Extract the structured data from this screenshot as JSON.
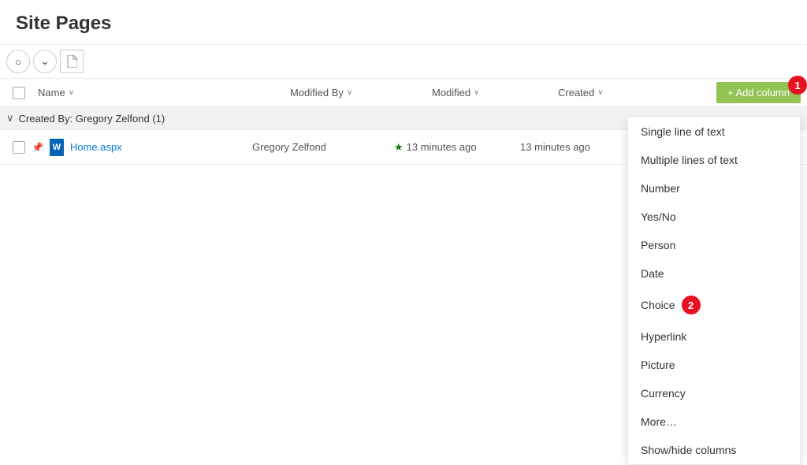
{
  "page": {
    "title": "Site Pages"
  },
  "toolbar": {
    "circle_btn": "○",
    "chevron_btn": "⌄",
    "file_btn": "🗋"
  },
  "columns": {
    "name": "Name",
    "modified_by": "Modified By",
    "modified": "Modified",
    "created": "Created",
    "add_column": "+ Add column"
  },
  "group": {
    "label": "Created By: Gregory Zelfond (1)"
  },
  "rows": [
    {
      "name": "Home.aspx",
      "modified_by": "Gregory Zelfond",
      "modified": "13 minutes ago",
      "created": "13 minutes ago"
    }
  ],
  "dropdown": {
    "items": [
      "Single line of text",
      "Multiple lines of text",
      "Number",
      "Yes/No",
      "Person",
      "Date",
      "Choice",
      "Hyperlink",
      "Picture",
      "Currency",
      "More…",
      "Show/hide columns"
    ]
  },
  "badges": {
    "one": "1",
    "two": "2"
  }
}
